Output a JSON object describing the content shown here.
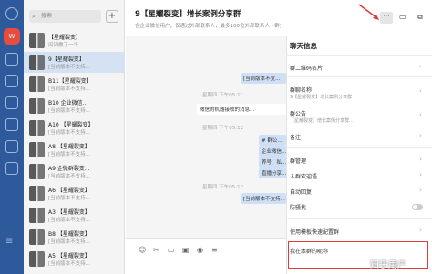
{
  "search": {
    "placeholder": "搜索"
  },
  "list": [
    {
      "name": "【星耀裂变】",
      "preview": "闪闪撒了一个..."
    },
    {
      "name": "9【星耀裂变】",
      "preview": "[当前版本不支持..."
    },
    {
      "name": "B11【星耀裂变】",
      "preview": "[当前版本不支持..."
    },
    {
      "name": "B10 企业微信...",
      "preview": "[当前版本不支持..."
    },
    {
      "name": "A10 【星耀裂变】",
      "preview": "[当前版本不支持..."
    },
    {
      "name": "A8 【星耀裂变】",
      "preview": "[当前版本不支持..."
    },
    {
      "name": "A9 企微群裂变...",
      "preview": "[当前版本不支持..."
    },
    {
      "name": "A6 【星耀裂变】",
      "preview": "[当前版本不支持..."
    },
    {
      "name": "A3 【星耀裂变】",
      "preview": "[当前版本不支持..."
    },
    {
      "name": "B8 【星耀裂变】",
      "preview": "[当前版本不支持..."
    },
    {
      "name": "A5 【星耀裂变】",
      "preview": "[当前版本不支持..."
    }
  ],
  "chat": {
    "title": "9【星耀裂变】增长案例分享群",
    "subtitle": "含企业微信用户，仅通过外部联系人，最多100位外部联系人 · 群主: 肌肉的运营..."
  },
  "messages": [
    {
      "text": "[当前版本不支..."
    },
    {
      "text": "星期四 下午05:11"
    },
    {
      "text": "微信的机器接收的消息..."
    },
    {
      "text": "星期四 下午05:12"
    },
    {
      "text": "# 群公..."
    },
    {
      "text": "企业微信..."
    },
    {
      "text": "养号，私..."
    },
    {
      "text": "直播分享..."
    },
    {
      "text": "星期四 下午05:12"
    },
    {
      "text": "[当前版本不支持..."
    }
  ],
  "toolbar": {
    "icons": [
      "smiley-icon",
      "scissors-icon",
      "folder-icon",
      "image-icon",
      "mic-icon",
      "menu-icon"
    ]
  },
  "panel": {
    "header": "聊天信息",
    "qr_label": "群二维码名片",
    "name_label": "群聊名称",
    "name_value": "9【星耀裂变】增长案例分享群",
    "notice_label": "群公告",
    "notice_value": "【星耀裂变】增长案例分享群...",
    "remark_label": "备注",
    "manage_label": "群管理",
    "welcome_label": "入群欢迎语",
    "autoreply_label": "自动回复",
    "antispam_label": "防骚扰",
    "template_label": "使用模板快速配置群",
    "nickname_label": "我在本群的昵称"
  },
  "watermark": "知乎用户"
}
